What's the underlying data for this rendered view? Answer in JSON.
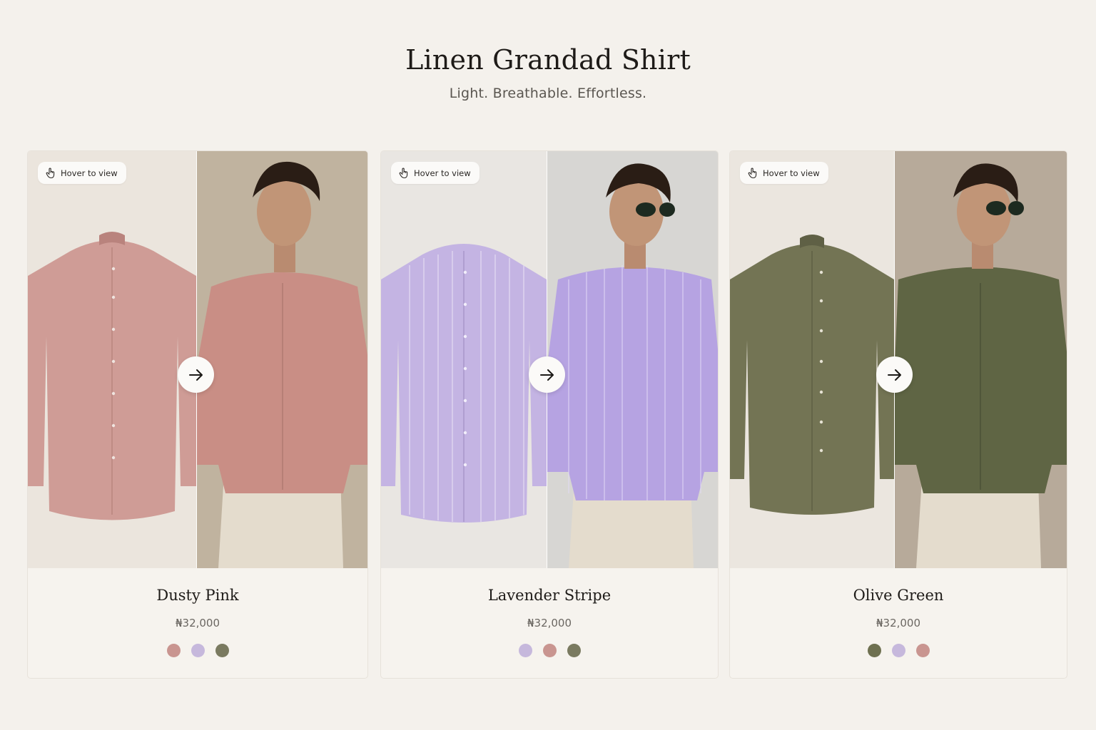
{
  "page": {
    "title": "Linen Grandad Shirt",
    "subtitle": "Light. Breathable. Effortless."
  },
  "colors": {
    "background": "#f4f1ec",
    "dusty_pink": "#c99590",
    "lavender": "#c6b8dc",
    "olive": "#7a7a60"
  },
  "products": [
    {
      "hover_label": "Hover to view",
      "hover_icon": "pointer-hand-icon",
      "arrow_icon": "arrow-right-icon",
      "name": "Dusty Pink",
      "price": "₦32,000",
      "swatches": [
        "#c99590",
        "#c6b8dc",
        "#7a7a60"
      ]
    },
    {
      "hover_label": "Hover to view",
      "hover_icon": "pointer-hand-icon",
      "arrow_icon": "arrow-right-icon",
      "name": "Lavender Stripe",
      "price": "₦32,000",
      "swatches": [
        "#c6b8dc",
        "#c99590",
        "#7a7a60"
      ]
    },
    {
      "hover_label": "Hover to view",
      "hover_icon": "pointer-hand-icon",
      "arrow_icon": "arrow-right-icon",
      "name": "Olive Green",
      "price": "₦32,000",
      "swatches": [
        "#6e7050",
        "#c6b8dc",
        "#c99590"
      ]
    }
  ]
}
